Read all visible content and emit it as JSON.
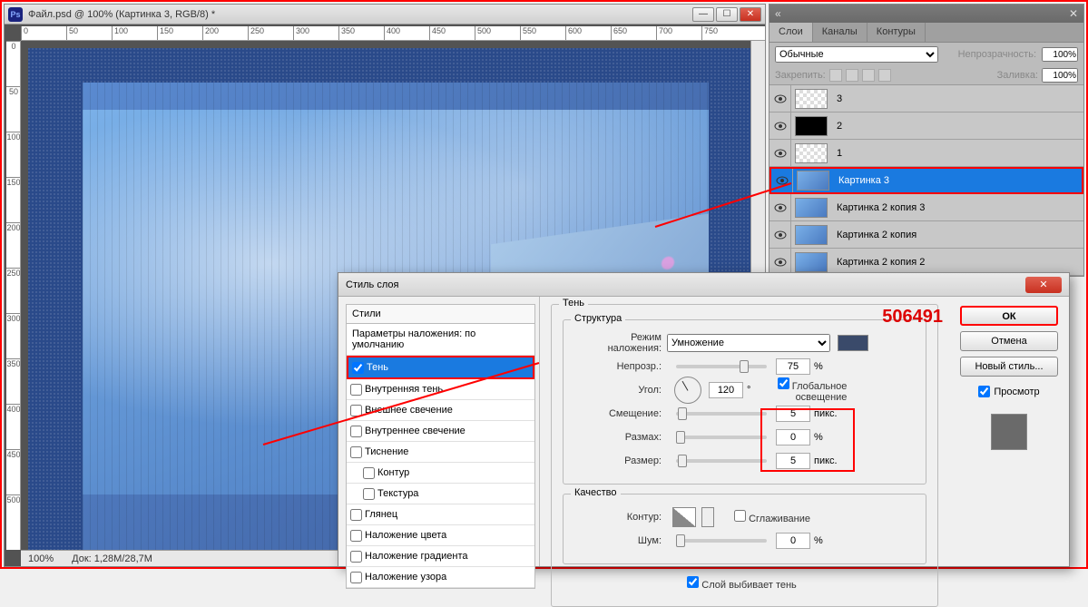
{
  "document": {
    "title": "Файл.psd @ 100% (Картинка 3, RGB/8) *",
    "zoom": "100%",
    "doc_info": "Док: 1,28M/28,7M",
    "ruler_h": [
      "0",
      "50",
      "100",
      "150",
      "200",
      "250",
      "300",
      "350",
      "400",
      "450",
      "500",
      "550",
      "600",
      "650",
      "700",
      "750"
    ],
    "ruler_v": [
      "0",
      "50",
      "100",
      "150",
      "200",
      "250",
      "300",
      "350",
      "400",
      "450",
      "500"
    ]
  },
  "layers_panel": {
    "tabs": [
      "Слои",
      "Каналы",
      "Контуры"
    ],
    "blend_mode": "Обычные",
    "opacity_label": "Непрозрачность:",
    "opacity_value": "100%",
    "lock_label": "Закрепить:",
    "fill_label": "Заливка:",
    "fill_value": "100%",
    "layers": [
      {
        "name": "3",
        "thumb": "checker"
      },
      {
        "name": "2",
        "thumb": "black"
      },
      {
        "name": "1",
        "thumb": "checker"
      },
      {
        "name": "Картинка 3",
        "thumb": "blue-img",
        "selected": true
      },
      {
        "name": "Картинка 2 копия 3",
        "thumb": "blue-img"
      },
      {
        "name": "Картинка 2 копия",
        "thumb": "blue-img"
      },
      {
        "name": "Картинка 2 копия 2",
        "thumb": "blue-img"
      }
    ]
  },
  "dialog": {
    "title": "Стиль слоя",
    "styles_header": "Стили",
    "defaults_label": "Параметры наложения: по умолчанию",
    "items": [
      {
        "label": "Тень",
        "checked": true,
        "selected": true
      },
      {
        "label": "Внутренняя тень",
        "checked": false
      },
      {
        "label": "Внешнее свечение",
        "checked": false
      },
      {
        "label": "Внутреннее свечение",
        "checked": false
      },
      {
        "label": "Тиснение",
        "checked": false
      },
      {
        "label": "Контур",
        "checked": false,
        "indent": true
      },
      {
        "label": "Текстура",
        "checked": false,
        "indent": true
      },
      {
        "label": "Глянец",
        "checked": false
      },
      {
        "label": "Наложение цвета",
        "checked": false
      },
      {
        "label": "Наложение градиента",
        "checked": false
      },
      {
        "label": "Наложение узора",
        "checked": false
      }
    ],
    "section_title": "Тень",
    "structure_title": "Структура",
    "blend_mode_label": "Режим наложения:",
    "blend_mode_value": "Умножение",
    "opacity_label": "Непрозр.:",
    "opacity_value": "75",
    "opacity_unit": "%",
    "angle_label": "Угол:",
    "angle_value": "120",
    "angle_unit": "°",
    "global_light_label": "Глобальное освещение",
    "distance_label": "Смещение:",
    "distance_value": "5",
    "distance_unit": "пикс.",
    "spread_label": "Размах:",
    "spread_value": "0",
    "spread_unit": "%",
    "size_label": "Размер:",
    "size_value": "5",
    "size_unit": "пикс.",
    "quality_title": "Качество",
    "contour_label": "Контур:",
    "antialias_label": "Сглаживание",
    "noise_label": "Шум:",
    "noise_value": "0",
    "noise_unit": "%",
    "knockout_label": "Слой выбивает тень",
    "buttons": {
      "ok": "ОК",
      "cancel": "Отмена",
      "new_style": "Новый стиль...",
      "preview": "Просмотр"
    }
  },
  "watermark": "506491"
}
